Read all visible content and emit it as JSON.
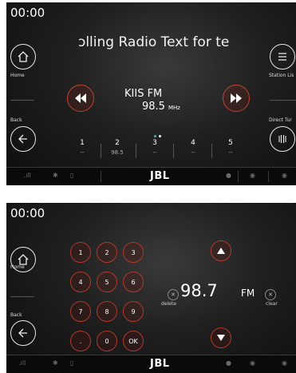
{
  "radio": {
    "clock": "00:00",
    "home_label": "Home",
    "back_label": "Back",
    "station_list_label": "Station Lis",
    "direct_tune_label": "Direct Tur",
    "radio_text": "ɔlling    Radio Text for te",
    "station_name": "KIIS FM",
    "frequency": "98.5",
    "frequency_unit": "MHz",
    "page_count": 2,
    "active_page": 1,
    "presets": [
      {
        "number": "1",
        "value": "--"
      },
      {
        "number": "2",
        "value": "98.5"
      },
      {
        "number": "3",
        "value": "--"
      },
      {
        "number": "4",
        "value": "--"
      },
      {
        "number": "5",
        "value": "--"
      }
    ],
    "brand": "JBL"
  },
  "direct_tune": {
    "clock": "00:00",
    "home_label": "Home",
    "back_label": "Back",
    "keys": [
      "1",
      "2",
      "3",
      "4",
      "5",
      "6",
      "7",
      "8",
      "9",
      ".",
      "0",
      "OK"
    ],
    "delete_label": "delete",
    "clear_label": "clear",
    "entered_frequency": "98.7",
    "band": "FM",
    "brand": "JBL"
  },
  "colors": {
    "accent": "#c0432f",
    "page_dot_active": "#3ab0e0",
    "page_dot_inactive": "#ffffff"
  }
}
